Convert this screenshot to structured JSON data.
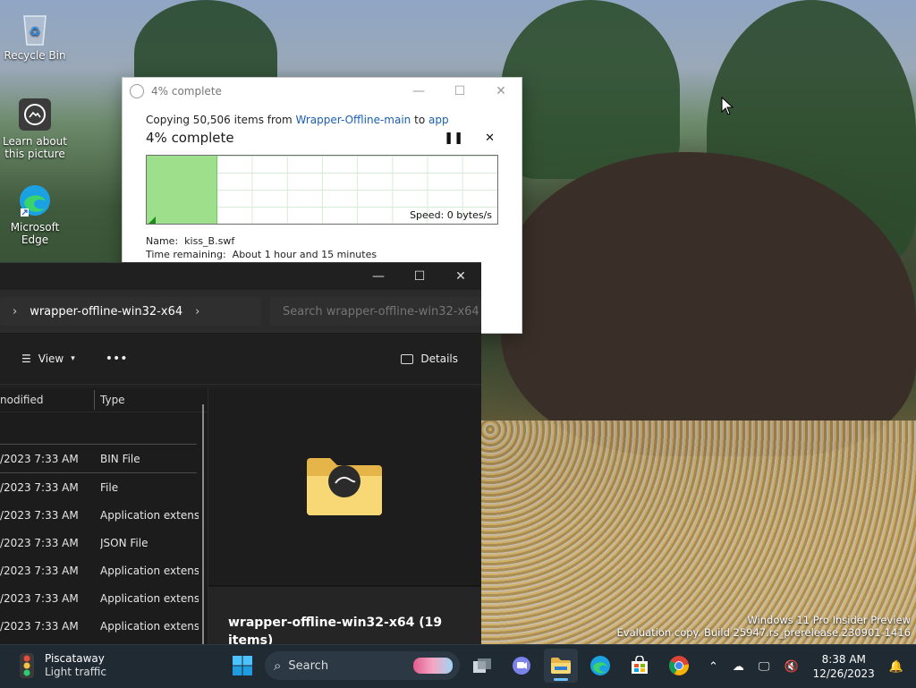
{
  "desktop": {
    "icons": [
      {
        "label": "Recycle Bin",
        "icon": "recycle-bin-icon"
      },
      {
        "label": "Learn about this picture",
        "icon": "camera-icon"
      },
      {
        "label": "Microsoft Edge",
        "icon": "edge-icon"
      }
    ]
  },
  "copy_dialog": {
    "title": "4% complete",
    "line_prefix": "Copying 50,506 items from",
    "source": "Wrapper-Offline-main",
    "connector": "to",
    "destination": "app",
    "percent_label": "4% complete",
    "progress": 4,
    "speed": "Speed: 0 bytes/s",
    "name_label": "Name:",
    "name_value": "kiss_B.swf",
    "time_label": "Time remaining:",
    "time_value": "About 1 hour and 15 minutes"
  },
  "explorer": {
    "breadcrumb": "wrapper-offline-win32-x64",
    "search_placeholder": "Search wrapper-offline-win32-x64",
    "toolbar": {
      "view_label": "View",
      "more_label": "•••",
      "details_label": "Details"
    },
    "columns": {
      "modified": "nodified",
      "type": "Type"
    },
    "rows": [
      {
        "modified": "/2023 7:33 AM",
        "type": "BIN File"
      },
      {
        "modified": "/2023 7:33 AM",
        "type": "File"
      },
      {
        "modified": "/2023 7:33 AM",
        "type": "Application extens..."
      },
      {
        "modified": "/2023 7:33 AM",
        "type": "JSON File"
      },
      {
        "modified": "/2023 7:33 AM",
        "type": "Application extens..."
      },
      {
        "modified": "/2023 7:33 AM",
        "type": "Application extens..."
      },
      {
        "modified": "/2023 7:33 AM",
        "type": "Application extens..."
      }
    ],
    "preview_title": "wrapper-offline-win32-x64 (19 items)"
  },
  "watermark": {
    "line1": "Windows 11 Pro Insider Preview",
    "line2": "Evaluation copy. Build 25947.rs_prerelease.230901-1416"
  },
  "taskbar": {
    "weather_title": "Piscataway",
    "weather_sub": "Light traffic",
    "search_label": "Search",
    "time": "8:38 AM",
    "date": "12/26/2023"
  },
  "colors": {
    "accent": "#1a5fb4",
    "progress_fill": "#9ddf8b",
    "taskbar": "#1f2a33",
    "explorer_bg": "#202020"
  }
}
